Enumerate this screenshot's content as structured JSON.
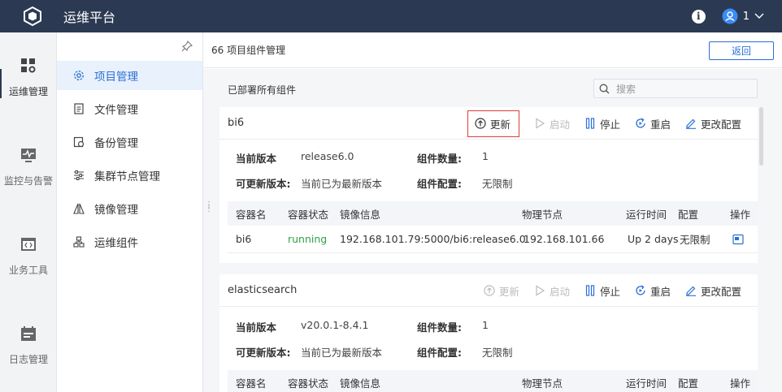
{
  "app": {
    "title": "运维平台",
    "user": "1"
  },
  "rail": [
    {
      "label": "运维管理",
      "icon": "grid-settings-icon",
      "active": true
    },
    {
      "label": "监控与告警",
      "icon": "monitor-icon",
      "active": false
    },
    {
      "label": "业务工具",
      "icon": "code-window-icon",
      "active": false
    },
    {
      "label": "日志管理",
      "icon": "calendar-log-icon",
      "active": false
    }
  ],
  "subnav": [
    {
      "label": "项目管理",
      "icon": "gear-icon",
      "active": true
    },
    {
      "label": "文件管理",
      "icon": "file-icon",
      "active": false
    },
    {
      "label": "备份管理",
      "icon": "backup-icon",
      "active": false
    },
    {
      "label": "集群节点管理",
      "icon": "sliders-icon",
      "active": false
    },
    {
      "label": "镜像管理",
      "icon": "image-mirror-icon",
      "active": false
    },
    {
      "label": "运维组件",
      "icon": "components-icon",
      "active": false
    }
  ],
  "page": {
    "breadcrumb": "66 项目组件管理",
    "back_label": "返回",
    "section_title": "已部署所有组件",
    "search_placeholder": "搜索"
  },
  "actions": {
    "update": "更新",
    "start": "启动",
    "stop": "停止",
    "restart": "重启",
    "config": "更改配置"
  },
  "labels": {
    "current_version": "当前版本",
    "updatable_version": "可更新版本:",
    "component_count": "组件数量:",
    "component_config": "组件配置:"
  },
  "table_headers": [
    "容器名",
    "容器状态",
    "镜像信息",
    "物理节点",
    "运行时间",
    "配置",
    "操作"
  ],
  "cards": [
    {
      "name": "bi6",
      "current_version": "release6.0",
      "updatable_version": "当前已为最新版本",
      "component_count": "1",
      "component_config": "无限制",
      "rows": [
        {
          "container": "bi6",
          "status": "running",
          "image": "192.168.101.79:5000/bi6:release6.0",
          "node": "192.168.101.66",
          "uptime": "Up 2 days",
          "config": "无限制"
        }
      ]
    },
    {
      "name": "elasticsearch",
      "current_version": "v20.0.1-8.4.1",
      "updatable_version": "当前已为最新版本",
      "component_count": "1",
      "component_config": "无限制",
      "rows": []
    }
  ],
  "colors": {
    "topbar": "#2b3a52",
    "accent": "#2b6fd6",
    "running": "#2ea043",
    "highlight": "#e03c3c"
  }
}
